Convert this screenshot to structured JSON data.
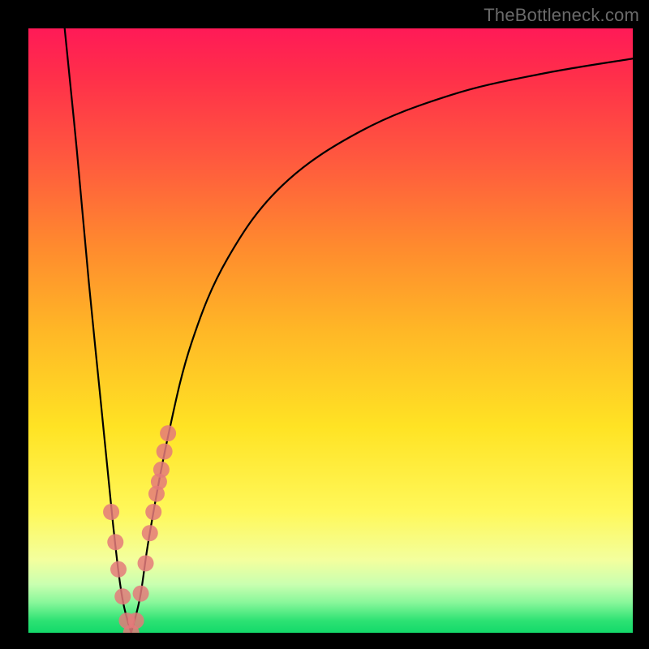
{
  "watermark": "TheBottleneck.com",
  "chart_data": {
    "type": "line",
    "title": "",
    "xlabel": "",
    "ylabel": "",
    "xlim": [
      0,
      100
    ],
    "ylim": [
      0,
      100
    ],
    "grid": false,
    "notes": "V-shaped bottleneck curve. Two black curves descend to a minimum near x≈17 then rise; colored background encodes bottleneck severity (red=high, green=low). Salmon dots mark sampled points near the minimum.",
    "series": [
      {
        "name": "left-branch",
        "color": "#000000",
        "x": [
          6,
          8,
          10,
          12,
          14,
          15.5,
          17
        ],
        "y": [
          100,
          80,
          58,
          38,
          18,
          6,
          0
        ]
      },
      {
        "name": "right-branch",
        "color": "#000000",
        "x": [
          17,
          18.5,
          20,
          23,
          27,
          33,
          42,
          55,
          70,
          85,
          100
        ],
        "y": [
          0,
          6,
          16,
          32,
          48,
          62,
          74,
          83,
          89,
          92.5,
          95
        ]
      }
    ],
    "sample_points": {
      "name": "sampled",
      "color": "#e47a7a",
      "x": [
        13.7,
        14.4,
        14.9,
        15.6,
        16.3,
        17.0,
        17.8,
        18.6,
        19.4,
        20.1,
        20.7,
        21.2,
        21.6,
        22.0,
        22.5,
        23.1
      ],
      "y": [
        20.0,
        15.0,
        10.5,
        6.0,
        2.0,
        0.0,
        2.0,
        6.5,
        11.5,
        16.5,
        20.0,
        23.0,
        25.0,
        27.0,
        30.0,
        33.0
      ]
    }
  }
}
